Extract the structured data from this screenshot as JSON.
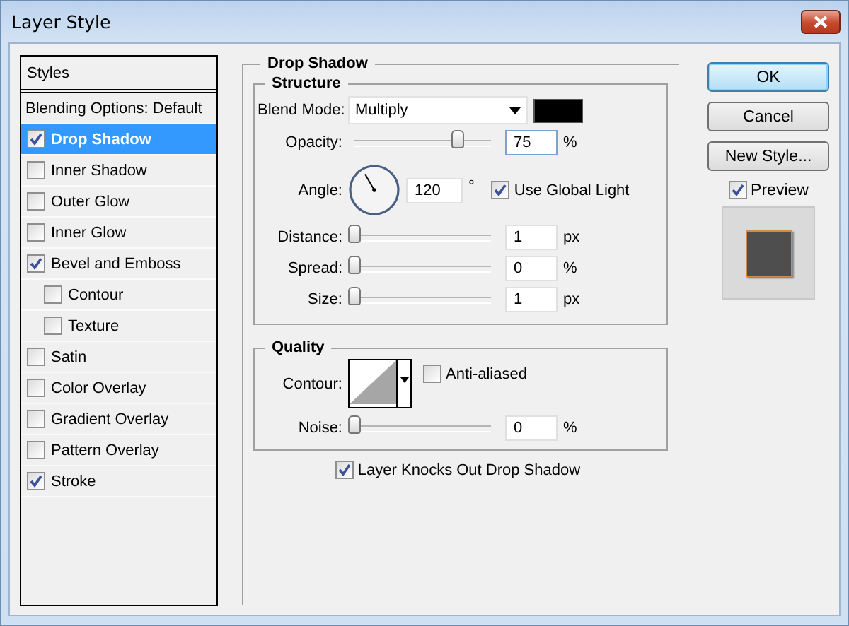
{
  "window": {
    "title": "Layer Style"
  },
  "styles_panel": {
    "header": "Styles",
    "items": [
      {
        "label": "Blending Options: Default",
        "kind": "plain",
        "selected": false
      },
      {
        "label": "Drop Shadow",
        "kind": "check",
        "checked": true,
        "selected": true
      },
      {
        "label": "Inner Shadow",
        "kind": "check",
        "checked": false,
        "selected": false
      },
      {
        "label": "Outer Glow",
        "kind": "check",
        "checked": false,
        "selected": false
      },
      {
        "label": "Inner Glow",
        "kind": "check",
        "checked": false,
        "selected": false
      },
      {
        "label": "Bevel and Emboss",
        "kind": "check",
        "checked": true,
        "selected": false,
        "children": [
          {
            "label": "Contour",
            "kind": "check",
            "checked": false,
            "selected": false
          },
          {
            "label": "Texture",
            "kind": "check",
            "checked": false,
            "selected": false
          }
        ]
      },
      {
        "label": "Satin",
        "kind": "check",
        "checked": false,
        "selected": false
      },
      {
        "label": "Color Overlay",
        "kind": "check",
        "checked": false,
        "selected": false
      },
      {
        "label": "Gradient Overlay",
        "kind": "check",
        "checked": false,
        "selected": false
      },
      {
        "label": "Pattern Overlay",
        "kind": "check",
        "checked": false,
        "selected": false
      },
      {
        "label": "Stroke",
        "kind": "check",
        "checked": true,
        "selected": false
      }
    ]
  },
  "drop_shadow": {
    "title": "Drop Shadow",
    "structure": {
      "title": "Structure",
      "blend_mode": {
        "label": "Blend Mode:",
        "value": "Multiply"
      },
      "opacity": {
        "label": "Opacity:",
        "level": 0.75,
        "value": "75",
        "unit": "%"
      },
      "angle": {
        "label": "Angle:",
        "value": "120",
        "unit": "°",
        "global_light": {
          "label": "Use Global Light",
          "checked": true
        }
      },
      "sliders": [
        {
          "label": "Distance:",
          "level": 0,
          "value": "1",
          "unit": "px"
        },
        {
          "label": "Spread:",
          "level": 0,
          "value": "0",
          "unit": "%"
        },
        {
          "label": "Size:",
          "level": 0,
          "value": "1",
          "unit": "px"
        }
      ]
    },
    "quality": {
      "title": "Quality",
      "contour": {
        "label": "Contour:"
      },
      "anti_aliased": {
        "label": "Anti-aliased",
        "checked": false
      },
      "noise": {
        "label": "Noise:",
        "level": 0,
        "value": "0",
        "unit": "%"
      }
    },
    "knockout": {
      "label": "Layer Knocks Out Drop Shadow",
      "checked": true
    }
  },
  "buttons": [
    {
      "label": "OK",
      "default": true
    },
    {
      "label": "Cancel",
      "default": false
    },
    {
      "label": "New Style...",
      "default": false
    }
  ],
  "preview": {
    "label": "Preview",
    "checked": true
  }
}
